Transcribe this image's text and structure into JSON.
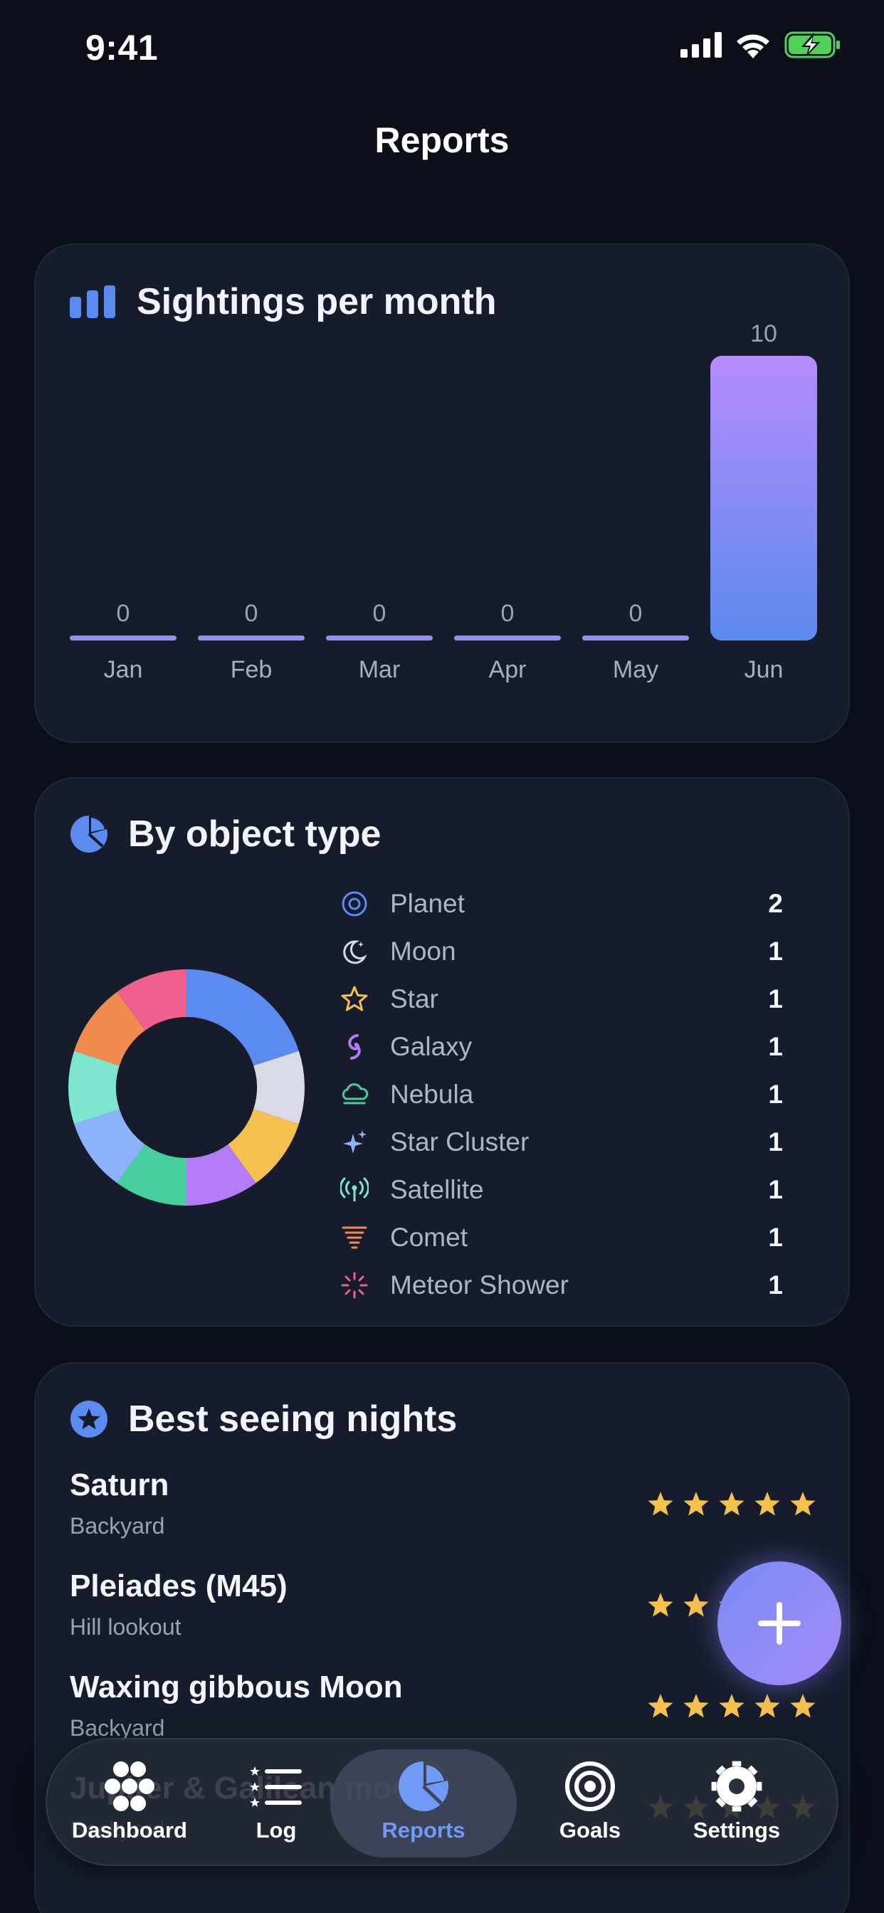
{
  "status": {
    "time": "9:41"
  },
  "page": {
    "title": "Reports"
  },
  "chart_card": {
    "title": "Sightings per month"
  },
  "chart_data": {
    "type": "bar",
    "title": "Sightings per month",
    "categories": [
      "Jan",
      "Feb",
      "Mar",
      "Apr",
      "May",
      "Jun"
    ],
    "values": [
      0,
      0,
      0,
      0,
      0,
      10
    ],
    "ylim": [
      0,
      10
    ],
    "grid": false
  },
  "type_card": {
    "title": "By object type",
    "items": [
      {
        "label": "Planet",
        "count": "2",
        "color": "#5b8af0",
        "icon": "planet-icon"
      },
      {
        "label": "Moon",
        "count": "1",
        "color": "#d8dbe6",
        "icon": "moon-icon"
      },
      {
        "label": "Star",
        "count": "1",
        "color": "#f4c14d",
        "icon": "star-icon"
      },
      {
        "label": "Galaxy",
        "count": "1",
        "color": "#b37cf6",
        "icon": "galaxy-icon"
      },
      {
        "label": "Nebula",
        "count": "1",
        "color": "#46cf9c",
        "icon": "nebula-icon"
      },
      {
        "label": "Star Cluster",
        "count": "1",
        "color": "#8cb2fb",
        "icon": "star-cluster-icon"
      },
      {
        "label": "Satellite",
        "count": "1",
        "color": "#7ee5cf",
        "icon": "satellite-icon"
      },
      {
        "label": "Comet",
        "count": "1",
        "color": "#f08a4f",
        "icon": "comet-icon"
      },
      {
        "label": "Meteor Shower",
        "count": "1",
        "color": "#f05f8e",
        "icon": "meteor-shower-icon"
      }
    ]
  },
  "best_card": {
    "title": "Best seeing nights",
    "rows": [
      {
        "name": "Saturn",
        "place": "Backyard",
        "rating": 5
      },
      {
        "name": "Pleiades (M45)",
        "place": "Hill lookout",
        "rating": 5
      },
      {
        "name": "Waxing gibbous Moon",
        "place": "Backyard",
        "rating": 5
      },
      {
        "name": "Jupiter & Galilean moons",
        "place": "Backyard",
        "rating": 5
      }
    ]
  },
  "tabs": [
    {
      "label": "Dashboard",
      "icon": "dashboard-icon"
    },
    {
      "label": "Log",
      "icon": "log-icon"
    },
    {
      "label": "Reports",
      "icon": "reports-icon"
    },
    {
      "label": "Goals",
      "icon": "goals-icon"
    },
    {
      "label": "Settings",
      "icon": "settings-icon"
    }
  ],
  "colors": {
    "accent": "#5b8af0",
    "star": "#f4c14d",
    "background": "#0b0f19",
    "card": "#161c2b"
  }
}
